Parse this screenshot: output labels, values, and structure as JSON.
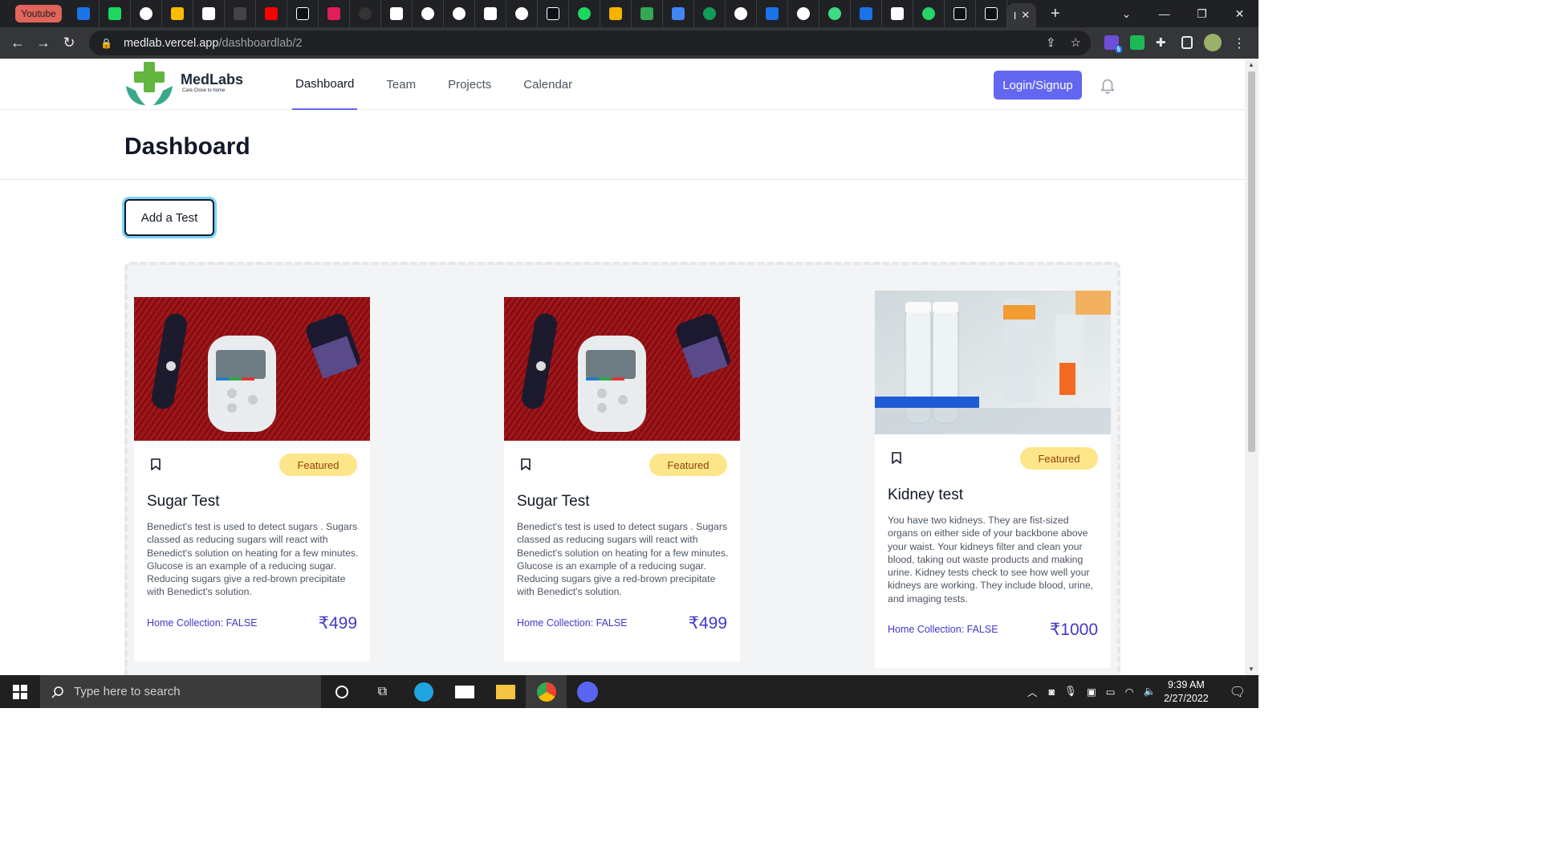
{
  "browser": {
    "pinned_tab_label": "Youtube",
    "active_tab_label": "I",
    "url_host": "medlab.vercel.app",
    "url_path": "/dashboardlab/2",
    "extension_badge": "5"
  },
  "nav": {
    "logo_text": "MedLabs",
    "logo_tagline": "Care Close to home",
    "items": [
      {
        "label": "Dashboard",
        "active": true
      },
      {
        "label": "Team",
        "active": false
      },
      {
        "label": "Projects",
        "active": false
      },
      {
        "label": "Calendar",
        "active": false
      }
    ],
    "login_label": "Login/Signup"
  },
  "page": {
    "title": "Dashboard",
    "add_test_label": "Add a Test"
  },
  "cards": [
    {
      "image": "glucose-meter-photo",
      "badge": "Featured",
      "title": "Sugar Test",
      "description": "Benedict's test is used to detect sugars . Sugars classed as reducing sugars will react with Benedict's solution on heating for a few minutes. Glucose is an example of a reducing sugar. Reducing sugars give a red-brown precipitate with Benedict's solution.",
      "home_collection": "Home Collection: FALSE",
      "price": "₹499"
    },
    {
      "image": "glucose-meter-photo",
      "badge": "Featured",
      "title": "Sugar Test",
      "description": "Benedict's test is used to detect sugars . Sugars classed as reducing sugars will react with Benedict's solution on heating for a few minutes. Glucose is an example of a reducing sugar. Reducing sugars give a red-brown precipitate with Benedict's solution.",
      "home_collection": "Home Collection: FALSE",
      "price": "₹499"
    },
    {
      "image": "lab-test-tubes-photo",
      "badge": "Featured",
      "title": "Kidney test",
      "description": "You have two kidneys. They are fist-sized organs on either side of your backbone above your waist. Your kidneys filter and clean your blood, taking out waste products and making urine. Kidney tests check to see how well your kidneys are working. They include blood, urine, and imaging tests.",
      "home_collection": "Home Collection: FALSE",
      "price": "₹1000"
    }
  ],
  "taskbar": {
    "search_placeholder": "Type here to search",
    "time": "9:39 AM",
    "date": "2/27/2022"
  },
  "colors": {
    "accent": "#6366f1",
    "badge_bg": "#fde68a",
    "price": "#4338ca",
    "browser_dark": "#202124"
  }
}
